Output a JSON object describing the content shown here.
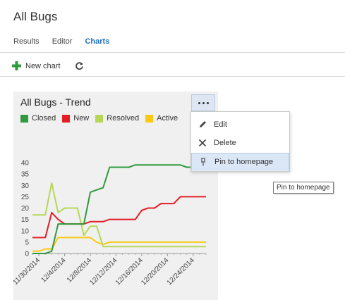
{
  "page": {
    "title": "All Bugs"
  },
  "tabs": [
    {
      "label": "Results"
    },
    {
      "label": "Editor"
    },
    {
      "label": "Charts",
      "active": true
    }
  ],
  "toolbar": {
    "new_chart_label": "New chart",
    "refresh_icon": "refresh-icon",
    "add_icon": "plus-icon"
  },
  "chart_tile": {
    "title": "All Bugs - Trend",
    "menu": {
      "items": [
        {
          "label": "Edit",
          "icon": "pencil-icon"
        },
        {
          "label": "Delete",
          "icon": "close-icon"
        },
        {
          "label": "Pin to homepage",
          "icon": "pin-icon"
        }
      ]
    },
    "tooltip": "Pin to homepage"
  },
  "chart_data": {
    "type": "line",
    "title": "All Bugs - Trend",
    "xlabel": "",
    "ylabel": "",
    "ylim": [
      0,
      40
    ],
    "yticks": [
      0,
      5,
      10,
      15,
      20,
      25,
      30,
      35,
      40
    ],
    "xtick_labels": [
      "11/30/2014",
      "12/4/2014",
      "12/8/2014",
      "12/12/2014",
      "12/16/2014",
      "12/20/2014",
      "12/24/2014"
    ],
    "x": [
      "11/29/2014",
      "11/30/2014",
      "12/1/2014",
      "12/2/2014",
      "12/3/2014",
      "12/4/2014",
      "12/5/2014",
      "12/6/2014",
      "12/7/2014",
      "12/8/2014",
      "12/9/2014",
      "12/10/2014",
      "12/11/2014",
      "12/12/2014",
      "12/13/2014",
      "12/14/2014",
      "12/15/2014",
      "12/16/2014",
      "12/17/2014",
      "12/18/2014",
      "12/19/2014",
      "12/20/2014",
      "12/21/2014",
      "12/22/2014",
      "12/23/2014",
      "12/24/2014",
      "12/25/2014",
      "12/26/2014"
    ],
    "legend_position": "top-left",
    "grid": false,
    "series": [
      {
        "name": "Closed",
        "color": "#2f9a3e",
        "values": [
          0,
          0,
          0,
          1,
          13,
          13,
          13,
          13,
          13,
          27,
          28,
          29,
          38,
          38,
          38,
          38,
          39,
          39,
          39,
          39,
          39,
          39,
          39,
          39,
          38,
          38,
          38,
          38
        ]
      },
      {
        "name": "New",
        "color": "#e31e25",
        "values": [
          7,
          7,
          7,
          18,
          15,
          13,
          13,
          13,
          13,
          14,
          14,
          14,
          15,
          15,
          15,
          15,
          15,
          19,
          20,
          20,
          22,
          22,
          22,
          25,
          25,
          25,
          25,
          25
        ]
      },
      {
        "name": "Resolved",
        "color": "#b6d756",
        "values": [
          17,
          17,
          17,
          31,
          18,
          20,
          20,
          20,
          8,
          12,
          12,
          3,
          3,
          3,
          3,
          3,
          3,
          3,
          3,
          3,
          3,
          3,
          3,
          3,
          3,
          3,
          3,
          3
        ]
      },
      {
        "name": "Active",
        "color": "#f9c913",
        "values": [
          1,
          1,
          2,
          2,
          7,
          7,
          7,
          7,
          7,
          7,
          5,
          4,
          5,
          5,
          5,
          5,
          5,
          5,
          5,
          5,
          5,
          5,
          5,
          5,
          5,
          5,
          5,
          5
        ]
      }
    ]
  }
}
